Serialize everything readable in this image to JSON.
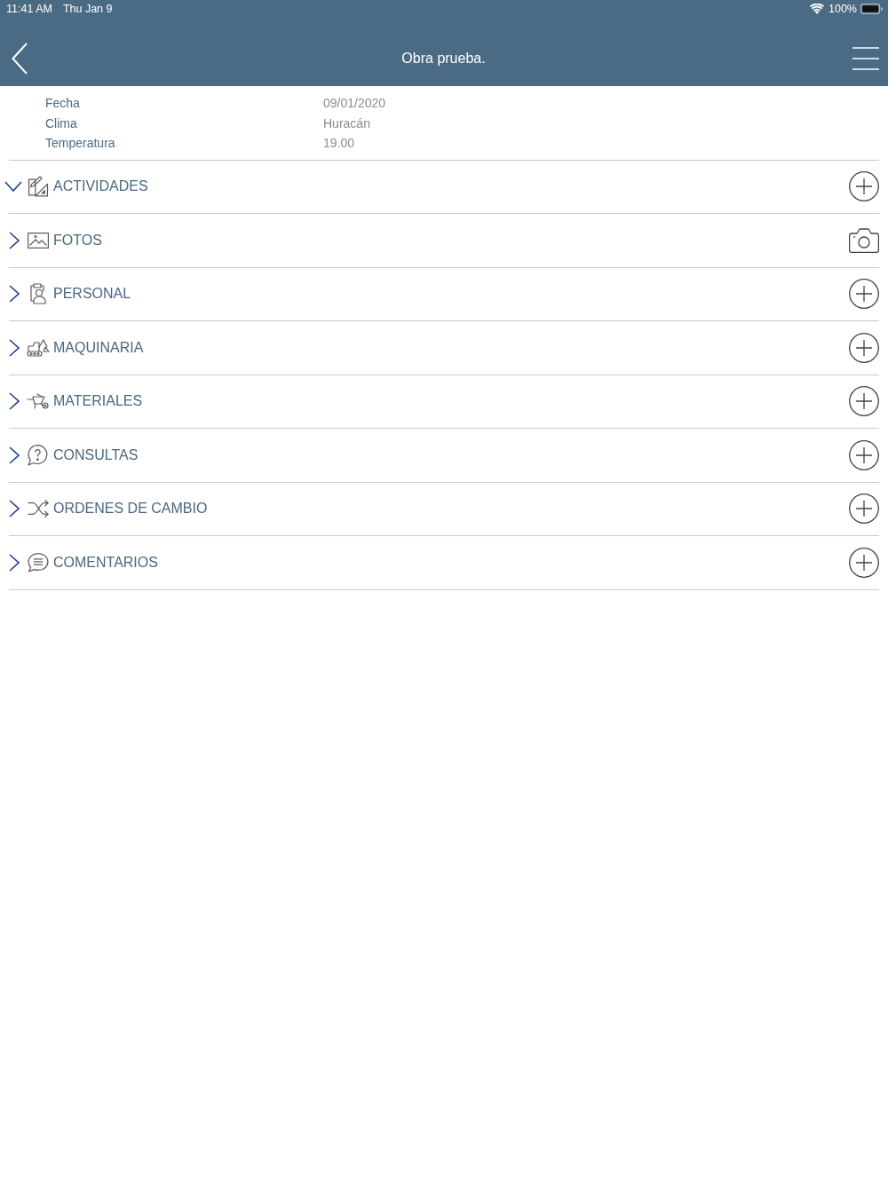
{
  "status_bar": {
    "time": "11:41 AM",
    "date": "Thu Jan 9",
    "battery": "100%"
  },
  "header": {
    "title": "Obra prueba."
  },
  "info": [
    {
      "label": "Fecha",
      "value": "09/01/2020"
    },
    {
      "label": "Clima",
      "value": "Huracán"
    },
    {
      "label": "Temperatura",
      "value": "19.00"
    }
  ],
  "sections": [
    {
      "kind": "activities",
      "label": "ACTIVIDADES",
      "expanded": true
    },
    {
      "kind": "photos",
      "label": "FOTOS",
      "expanded": false
    },
    {
      "kind": "staff",
      "label": "PERSONAL",
      "expanded": false
    },
    {
      "kind": "machinery",
      "label": "MAQUINARIA",
      "expanded": false
    },
    {
      "kind": "materials",
      "label": "MATERIALES",
      "expanded": false
    },
    {
      "kind": "queries",
      "label": "CONSULTAS",
      "expanded": false
    },
    {
      "kind": "changes",
      "label": "ORDENES DE CAMBIO",
      "expanded": false
    },
    {
      "kind": "comments",
      "label": "COMENTARIOS",
      "expanded": false
    }
  ]
}
